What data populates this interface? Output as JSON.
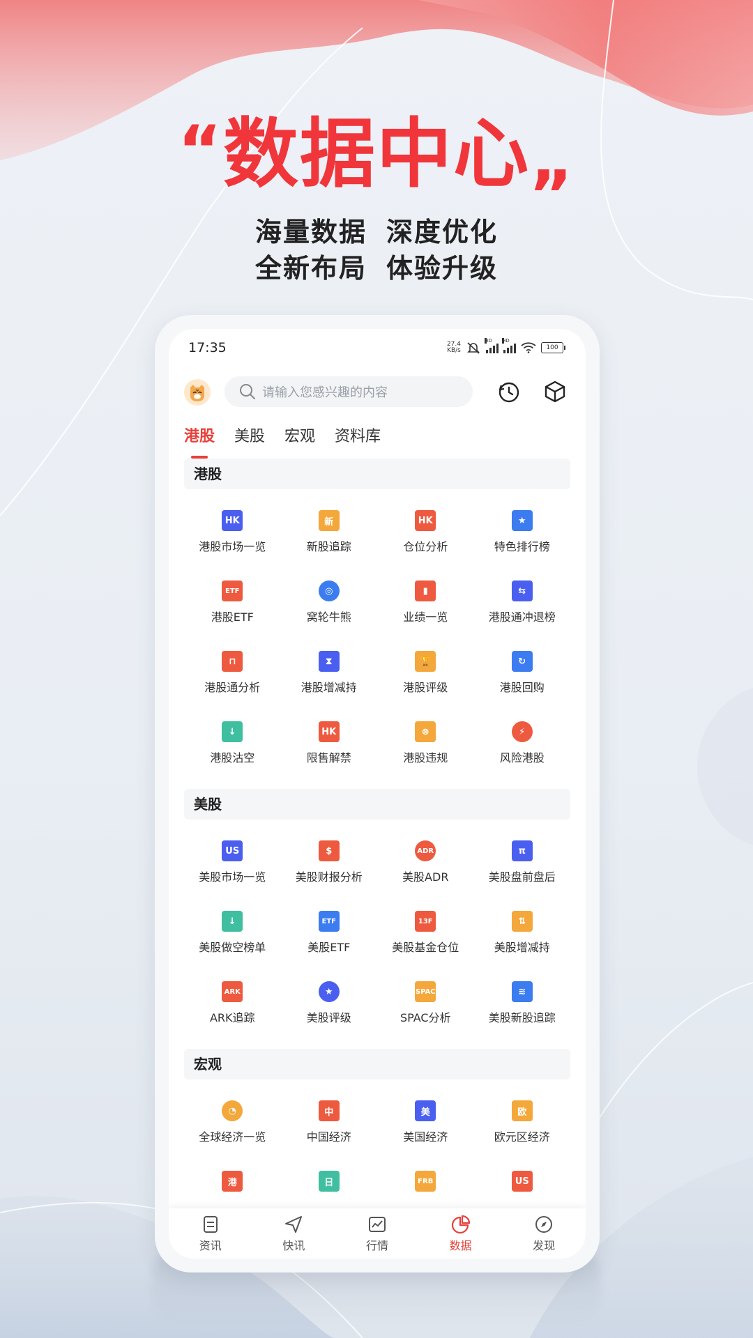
{
  "colors": {
    "accent": "#e8403a",
    "hero_red": "#f0363a"
  },
  "hero": {
    "quote_open": "“",
    "title": "数据中心",
    "quote_close": "„",
    "line1_a": "海量数据",
    "line1_b": "深度优化",
    "line2_a": "全新布局",
    "line2_b": "体验升级"
  },
  "status": {
    "time": "17:35",
    "net_speed_top": "27.4",
    "net_speed_bottom": "KB/s",
    "hd": "HD",
    "battery": "100"
  },
  "topbar": {
    "search_placeholder": "请输入您感兴趣的内容",
    "avatar_icon": "tiger-avatar",
    "history_icon": "history-icon",
    "cube_icon": "cube-icon"
  },
  "tabs": [
    {
      "label": "港股",
      "active": true
    },
    {
      "label": "美股",
      "active": false
    },
    {
      "label": "宏观",
      "active": false
    },
    {
      "label": "资料库",
      "active": false
    }
  ],
  "sections": [
    {
      "title": "港股",
      "items": [
        {
          "label": "港股市场一览",
          "glyph": "HK",
          "color": "#4a5ff0",
          "icon": "hk-market-icon"
        },
        {
          "label": "新股追踪",
          "glyph": "新",
          "color": "#f4a73a",
          "icon": "new-stock-icon"
        },
        {
          "label": "仓位分析",
          "glyph": "HK",
          "color": "#ee5a3f",
          "icon": "position-house-icon"
        },
        {
          "label": "特色排行榜",
          "glyph": "★",
          "color": "#3b7cf0",
          "icon": "ranking-star-icon"
        },
        {
          "label": "港股ETF",
          "glyph": "ETF",
          "color": "#ee5a3f",
          "icon": "etf-icon"
        },
        {
          "label": "窝轮牛熊",
          "glyph": "◎",
          "color": "#3b7cf0",
          "icon": "warrant-icon"
        },
        {
          "label": "业绩一览",
          "glyph": "▮",
          "color": "#ee5a3f",
          "icon": "bar-chart-icon"
        },
        {
          "label": "港股通冲退榜",
          "glyph": "⇆",
          "color": "#4a5ff0",
          "icon": "connect-flow-icon"
        },
        {
          "label": "港股通分析",
          "glyph": "⊓",
          "color": "#ee5a3f",
          "icon": "connect-analysis-icon"
        },
        {
          "label": "港股增减持",
          "glyph": "⧗",
          "color": "#4a5ff0",
          "icon": "hourglass-icon"
        },
        {
          "label": "港股评级",
          "glyph": "🏆",
          "color": "#f4a73a",
          "icon": "trophy-icon"
        },
        {
          "label": "港股回购",
          "glyph": "↻",
          "color": "#3b7cf0",
          "icon": "buyback-icon"
        },
        {
          "label": "港股沽空",
          "glyph": "↓",
          "color": "#3fbf9f",
          "icon": "short-sell-icon"
        },
        {
          "label": "限售解禁",
          "glyph": "HK",
          "color": "#ee5a3f",
          "icon": "unlock-bag-icon"
        },
        {
          "label": "港股违规",
          "glyph": "⊗",
          "color": "#f4a73a",
          "icon": "violation-icon"
        },
        {
          "label": "风险港股",
          "glyph": "⚡",
          "color": "#ee5a3f",
          "icon": "risk-bolt-icon"
        }
      ]
    },
    {
      "title": "美股",
      "items": [
        {
          "label": "美股市场一览",
          "glyph": "US",
          "color": "#4a5ff0",
          "icon": "us-market-icon"
        },
        {
          "label": "美股财报分析",
          "glyph": "$",
          "color": "#ee5a3f",
          "icon": "earnings-icon"
        },
        {
          "label": "美股ADR",
          "glyph": "ADR",
          "color": "#ee5a3f",
          "icon": "adr-icon"
        },
        {
          "label": "美股盘前盘后",
          "glyph": "π",
          "color": "#4a5ff0",
          "icon": "pre-after-icon"
        },
        {
          "label": "美股做空榜单",
          "glyph": "↓",
          "color": "#3fbf9f",
          "icon": "us-short-icon"
        },
        {
          "label": "美股ETF",
          "glyph": "ETF",
          "color": "#3b7cf0",
          "icon": "us-etf-icon"
        },
        {
          "label": "美股基金仓位",
          "glyph": "13F",
          "color": "#ee5a3f",
          "icon": "fund-13f-icon"
        },
        {
          "label": "美股增减持",
          "glyph": "⇅",
          "color": "#f4a73a",
          "icon": "us-holding-change-icon"
        },
        {
          "label": "ARK追踪",
          "glyph": "ARK",
          "color": "#ee5a3f",
          "icon": "ark-icon"
        },
        {
          "label": "美股评级",
          "glyph": "★",
          "color": "#4a5ff0",
          "icon": "us-rating-star-icon"
        },
        {
          "label": "SPAC分析",
          "glyph": "SPAC",
          "color": "#f4a73a",
          "icon": "spac-icon"
        },
        {
          "label": "美股新股追踪",
          "glyph": "≋",
          "color": "#3b7cf0",
          "icon": "us-ipo-icon"
        }
      ]
    },
    {
      "title": "宏观",
      "items": [
        {
          "label": "全球经济一览",
          "glyph": "◔",
          "color": "#f4a73a",
          "icon": "global-pie-icon"
        },
        {
          "label": "中国经济",
          "glyph": "中",
          "color": "#ee5a3f",
          "icon": "china-economy-icon"
        },
        {
          "label": "美国经济",
          "glyph": "美",
          "color": "#4a5ff0",
          "icon": "us-economy-icon"
        },
        {
          "label": "欧元区经济",
          "glyph": "欧",
          "color": "#f4a73a",
          "icon": "euro-economy-icon"
        },
        {
          "label": "",
          "glyph": "港",
          "color": "#ee5a3f",
          "icon": "hk-economy-icon"
        },
        {
          "label": "",
          "glyph": "日",
          "color": "#3fbf9f",
          "icon": "japan-economy-icon"
        },
        {
          "label": "",
          "glyph": "FRB",
          "color": "#f4a73a",
          "icon": "frb-icon"
        },
        {
          "label": "",
          "glyph": "US",
          "color": "#ee5a3f",
          "icon": "us-bond-icon"
        }
      ]
    }
  ],
  "bottom_nav": [
    {
      "label": "资讯",
      "icon": "news-icon",
      "active": false
    },
    {
      "label": "快讯",
      "icon": "flash-send-icon",
      "active": false
    },
    {
      "label": "行情",
      "icon": "market-chart-icon",
      "active": false
    },
    {
      "label": "数据",
      "icon": "data-pie-icon",
      "active": true
    },
    {
      "label": "发现",
      "icon": "discover-compass-icon",
      "active": false
    }
  ]
}
